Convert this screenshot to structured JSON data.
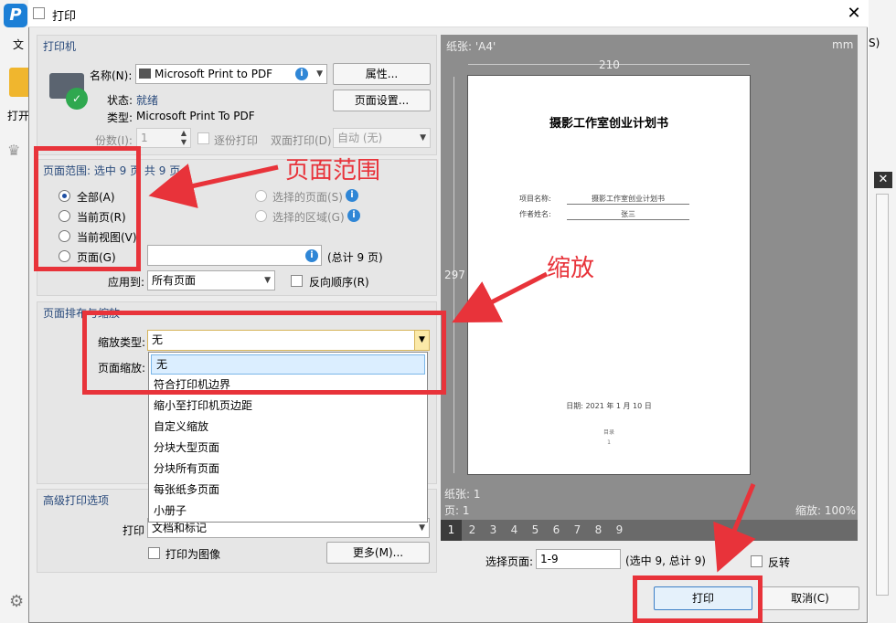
{
  "window": {
    "title": "打印",
    "close": "✕"
  },
  "app": {
    "logo": "P",
    "left_labels": [
      "文",
      "打开"
    ],
    "right_labels": [
      "S)",
      "S",
      "S"
    ]
  },
  "printer": {
    "section_title": "打印机",
    "name_label": "名称(N):",
    "name_value": "Microsoft Print to PDF",
    "status_label": "状态:",
    "status_value": "就绪",
    "type_label": "类型:",
    "type_value": "Microsoft Print To PDF",
    "properties_btn": "属性...",
    "page_setup_btn": "页面设置...",
    "copies_label": "份数(I):",
    "copies_value": "1",
    "collate_label": "逐份打印",
    "duplex_label": "双面打印(D)",
    "duplex_value": "自动 (无)"
  },
  "range": {
    "title": "页面范围: 选中 9 页 共 9 页",
    "all": "全部(A)",
    "current_page": "当前页(R)",
    "current_view": "当前视图(V)",
    "pages": "页面(G)",
    "selected_pages": "选择的页面(S)",
    "selected_area": "选择的区域(G)",
    "total": "(总计 9 页)",
    "apply_to_label": "应用到:",
    "apply_to_value": "所有页面",
    "reverse_label": "反向顺序(R)"
  },
  "layout": {
    "title": "页面排布与缩放",
    "scale_type_label": "缩放类型:",
    "scale_type_value": "无",
    "page_scale_label": "页面缩放:",
    "options": [
      "无",
      "符合打印机边界",
      "缩小至打印机页边距",
      "自定义缩放",
      "分块大型页面",
      "分块所有页面",
      "每张纸多页面",
      "小册子"
    ]
  },
  "advanced": {
    "title": "高级打印选项",
    "print_label": "打印",
    "print_value": "文档和标记",
    "as_image_label": "打印为图像",
    "more_btn": "更多(M)..."
  },
  "annotations": {
    "range_label": "页面范围",
    "zoom_label": "缩放"
  },
  "preview": {
    "paper_label": "纸张: 'A4'",
    "unit": "mm",
    "width_value": "210",
    "height_value": "297",
    "doc_title": "摄影工作室创业计划书",
    "project_label": "项目名称:",
    "project_value": "摄影工作室创业计划书",
    "author_label": "作者姓名:",
    "author_value": "张三",
    "date_line": "日期: 2021 年 1 月 10 日",
    "footer_small": "目录",
    "footer_num": "1",
    "sheet_info": "纸张: 1",
    "page_info": "页: 1",
    "zoom_info": "缩放: 100%",
    "page_numbers": [
      "1",
      "2",
      "3",
      "4",
      "5",
      "6",
      "7",
      "8",
      "9"
    ],
    "select_pages_label": "选择页面:",
    "select_pages_value": "1-9",
    "select_summary": "(选中 9, 总计 9)",
    "flip_label": "反转"
  },
  "footer": {
    "print_btn": "打印",
    "cancel_btn": "取消(C)"
  },
  "colors": {
    "accent": "#e8333a",
    "preview_bg": "#8d8d8d",
    "dialog_bg": "#ececec"
  }
}
